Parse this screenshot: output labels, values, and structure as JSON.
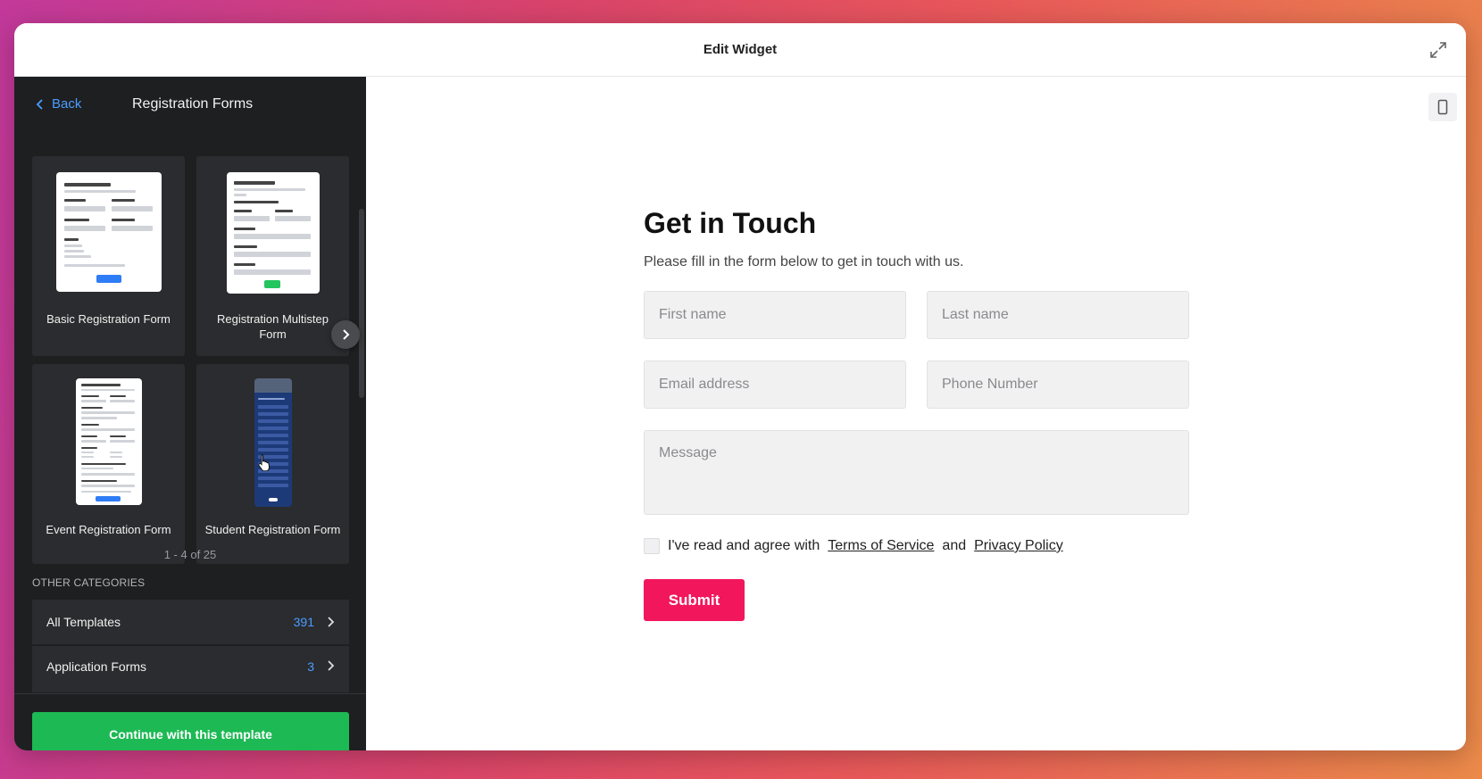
{
  "header": {
    "title": "Edit Widget",
    "expand_icon": "expand-icon"
  },
  "sidebar": {
    "back_label": "Back",
    "title": "Registration Forms",
    "templates": [
      {
        "label": "Basic Registration Form"
      },
      {
        "label": "Registration Multistep Form"
      },
      {
        "label": "Event Registration Form"
      },
      {
        "label": "Student Registration Form"
      }
    ],
    "pagination": "1 - 4 of 25",
    "other_categories_label": "OTHER CATEGORIES",
    "categories": [
      {
        "name": "All Templates",
        "count": "391"
      },
      {
        "name": "Application Forms",
        "count": "3"
      }
    ],
    "continue_label": "Continue with this template"
  },
  "preview": {
    "title": "Get in Touch",
    "subtitle": "Please fill in the form below to get in touch with us.",
    "fields": {
      "first_name": "First name",
      "last_name": "Last name",
      "email": "Email address",
      "phone": "Phone Number",
      "message": "Message"
    },
    "consent_prefix": "I've read and agree with",
    "terms_link": "Terms of Service",
    "consent_and": "and",
    "privacy_link": "Privacy Policy",
    "submit_label": "Submit"
  },
  "colors": {
    "accent_blue": "#4a9dff",
    "continue_green": "#1db954",
    "submit_pink": "#f2165c",
    "sidebar_bg": "#1e1f21"
  }
}
